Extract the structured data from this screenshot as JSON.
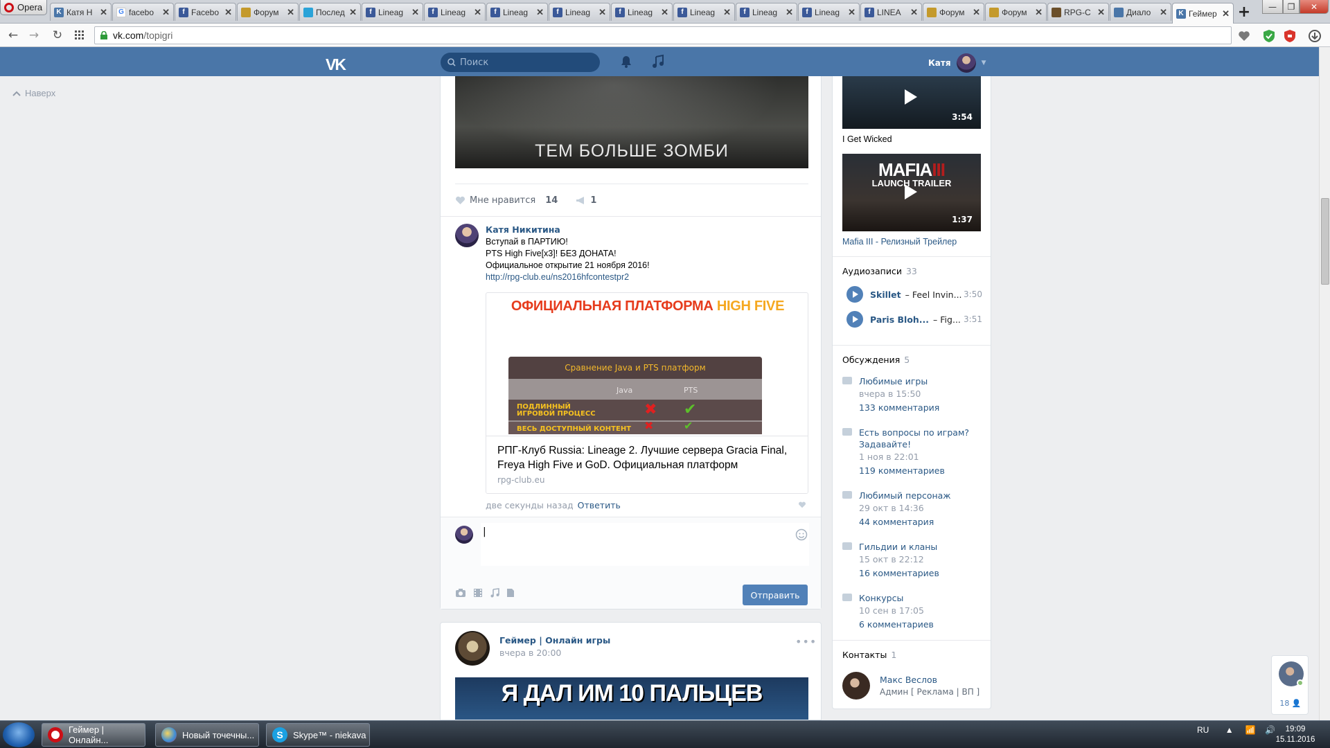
{
  "browser": {
    "opera_label": "Opera",
    "tabs": [
      {
        "label": "Катя Н",
        "fav": "vk",
        "color": "#4a76a8"
      },
      {
        "label": "facebo",
        "fav": "G",
        "color": "#ffffff"
      },
      {
        "label": "Facebo",
        "fav": "f",
        "color": "#3b5998"
      },
      {
        "label": "Форум",
        "fav": "crest",
        "color": "#c49a2c"
      },
      {
        "label": "Послед",
        "fav": "o",
        "color": "#2aa3d8"
      },
      {
        "label": "Lineag",
        "fav": "f",
        "color": "#3b5998"
      },
      {
        "label": "Lineag",
        "fav": "f",
        "color": "#3b5998"
      },
      {
        "label": "Lineag",
        "fav": "f",
        "color": "#3b5998"
      },
      {
        "label": "Lineag",
        "fav": "f",
        "color": "#3b5998"
      },
      {
        "label": "Lineag",
        "fav": "f",
        "color": "#3b5998"
      },
      {
        "label": "Lineag",
        "fav": "f",
        "color": "#3b5998"
      },
      {
        "label": "Lineag",
        "fav": "f",
        "color": "#3b5998"
      },
      {
        "label": "Lineag",
        "fav": "f",
        "color": "#3b5998"
      },
      {
        "label": "LINEA",
        "fav": "f",
        "color": "#3b5998"
      },
      {
        "label": "Форум",
        "fav": "crest",
        "color": "#c49a2c"
      },
      {
        "label": "Форум",
        "fav": "crest",
        "color": "#c49a2c"
      },
      {
        "label": "RPG-C",
        "fav": "rpg",
        "color": "#6b4f2a"
      },
      {
        "label": "Диало",
        "fav": "chat",
        "color": "#4a76a8"
      },
      {
        "label": "Геймер",
        "fav": "vk",
        "color": "#4a76a8",
        "active": true
      }
    ],
    "url_host": "vk.com",
    "url_path": "/topigri"
  },
  "vk": {
    "logo": "VK",
    "search_placeholder": "Поиск",
    "user_name": "Катя",
    "to_top": "Наверх"
  },
  "post1": {
    "image_caption": "ТЕМ БОЛЬШЕ ЗОМБИ",
    "like_label": "Мне нравится",
    "like_count": "14",
    "share_count": "1"
  },
  "comment": {
    "author": "Катя Никитина",
    "lines": [
      "Вступай в ПАРТИЮ!",
      "PTS High Five[x3]! БЕЗ ДОНАТА!",
      "Официальное открытие 21 ноября 2016!"
    ],
    "link": "http://rpg-club.eu/ns2016hfcontestpr2",
    "card": {
      "banner_main": "ОФИЦИАЛЬНАЯ ПЛАТФОРМА",
      "banner_accent": "HIGH FIVE",
      "table_title": "Сравнение Java и PTS платформ",
      "col_java": "Java",
      "col_pts": "PTS",
      "row1": "ПОДЛИННЫЙ ИГРОВОЙ ПРОЦЕСС",
      "row2": "ВЕСЬ ДОСТУПНЫЙ КОНТЕНТ",
      "title": "РПГ-Клуб Russia: Lineage 2. Лучшие сервера Gracia Final, Freya High Five и GoD. Официальная платформ",
      "domain": "rpg-club.eu"
    },
    "time": "две секунды назад",
    "reply": "Ответить",
    "input_value": "",
    "send_label": "Отправить"
  },
  "post2": {
    "author": "Геймер | Онлайн игры",
    "time": "вчера в 20:00",
    "dots": "•••",
    "image_caption": "Я ДАЛ ИМ 10 ПАЛЬЦЕВ"
  },
  "sidebar": {
    "videos": [
      {
        "title": "I Get Wicked",
        "duration": "3:54"
      },
      {
        "title": "Mafia III - Релизный Трейлер",
        "duration": "1:37",
        "thumb_main": "MAFIA",
        "thumb_num": "III",
        "thumb_sub": "LAUNCH TRAILER"
      }
    ],
    "audio_label": "Аудиозаписи",
    "audio_count": "33",
    "tracks": [
      {
        "artist": "Skillet",
        "title": "Feel Invin...",
        "duration": "3:50"
      },
      {
        "artist": "Paris Bloh...",
        "title": "Fig...",
        "duration": "3:51"
      }
    ],
    "discussions_label": "Обсуждения",
    "discussions_count": "5",
    "discussions": [
      {
        "title": "Любимые игры",
        "date": "вчера в 15:50",
        "comments": "133 комментария"
      },
      {
        "title": "Есть вопросы по играм? Задавайте!",
        "date": "1 ноя в 22:01",
        "comments": "119 комментариев"
      },
      {
        "title": "Любимый персонаж",
        "date": "29 окт в 14:36",
        "comments": "44 комментария"
      },
      {
        "title": "Гильдии и кланы",
        "date": "15 окт в 22:12",
        "comments": "16 комментариев"
      },
      {
        "title": "Конкурсы",
        "date": "10 сен в 17:05",
        "comments": "6 комментариев"
      }
    ],
    "contacts_label": "Контакты",
    "contacts_count": "1",
    "contact_name": "Макс Веслов",
    "contact_role": "Админ [ Реклама | ВП ]"
  },
  "chat_widget": {
    "count": "18"
  },
  "taskbar": {
    "items": [
      {
        "label": "Геймер | Онлайн...",
        "icon": "opera-icon"
      },
      {
        "label": "Новый точечны...",
        "icon": "paint-icon"
      },
      {
        "label": "Skype™ - niekava",
        "icon": "skype-icon"
      }
    ],
    "lang": "RU",
    "time": "19:09",
    "date": "15.11.2016"
  },
  "colors": {
    "vk_blue": "#4a76a8",
    "link": "#2a5885",
    "button": "#5181b8"
  }
}
